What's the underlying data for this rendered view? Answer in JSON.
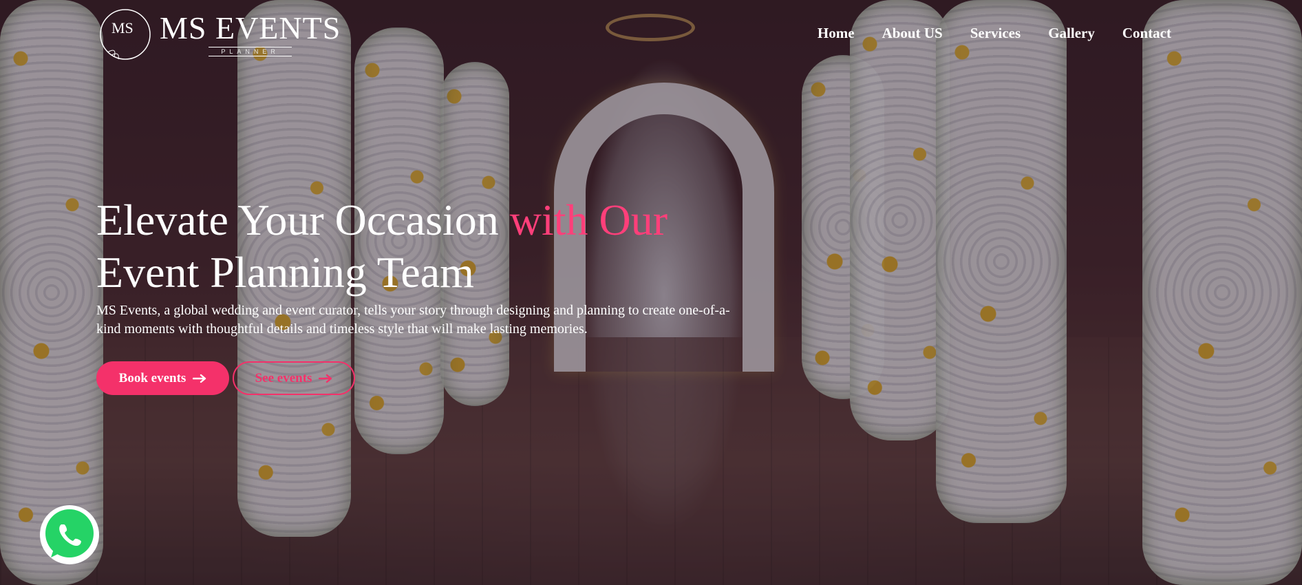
{
  "brand": {
    "monogram": "MS",
    "name": "MS EVENTS",
    "tagline": "PLANNER"
  },
  "nav": {
    "items": [
      {
        "label": "Home"
      },
      {
        "label": "About US"
      },
      {
        "label": "Services"
      },
      {
        "label": "Gallery"
      },
      {
        "label": "Contact"
      }
    ]
  },
  "hero": {
    "headline_part1": "Elevate Your Occasion ",
    "headline_accent": "with Our",
    "headline_part2": "Event Planning Team",
    "lead": "MS Events, a global wedding and event curator, tells your story through designing and planning to create one-of-a-kind moments with thoughtful details and timeless style that will make lasting memories.",
    "primary_button": "Book events",
    "secondary_button": "See events"
  },
  "icons": {
    "button_arrow": "arrow-right-icon",
    "chat": "whatsapp-icon"
  },
  "colors": {
    "accent": "#f4316a",
    "headline_accent": "#ff3f7a",
    "whatsapp_green": "#25d366",
    "text": "#ffffff"
  }
}
